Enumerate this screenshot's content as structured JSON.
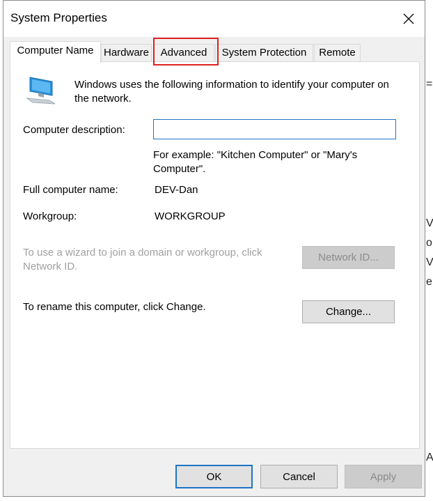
{
  "dialog": {
    "title": "System Properties",
    "close_label": "✕"
  },
  "tabs": [
    {
      "label": "Computer Name",
      "active": true
    },
    {
      "label": "Hardware",
      "active": false
    },
    {
      "label": "Advanced",
      "active": false
    },
    {
      "label": "System Protection",
      "active": false
    },
    {
      "label": "Remote",
      "active": false
    }
  ],
  "panel": {
    "intro": "Windows uses the following information to identify your computer on the network.",
    "description_label": "Computer description:",
    "description_value": "",
    "example_text": "For example: \"Kitchen Computer\" or \"Mary's Computer\".",
    "full_name_label": "Full computer name:",
    "full_name_value": "DEV-Dan",
    "workgroup_label": "Workgroup:",
    "workgroup_value": "WORKGROUP",
    "wizard_text": "To use a wizard to join a domain or workgroup, click Network ID.",
    "network_id_button": "Network ID...",
    "rename_text": "To rename this computer, click Change.",
    "change_button": "Change..."
  },
  "footer": {
    "ok": "OK",
    "cancel": "Cancel",
    "apply": "Apply"
  },
  "background_glyphs": [
    "=",
    "V",
    "o",
    "V",
    "e",
    "A"
  ]
}
